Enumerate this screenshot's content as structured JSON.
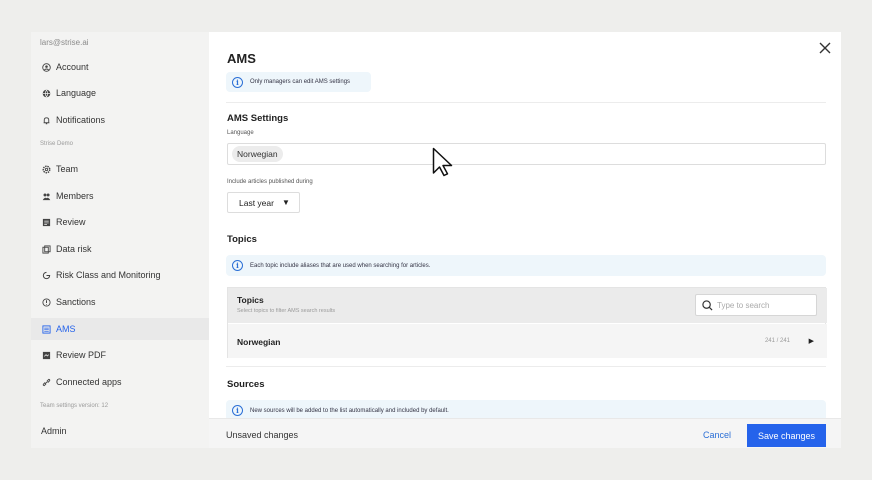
{
  "sidebar": {
    "email": "lars@strise.ai",
    "items_top": [
      {
        "label": "Account",
        "icon": "account-icon"
      },
      {
        "label": "Language",
        "icon": "globe-icon"
      },
      {
        "label": "Notifications",
        "icon": "bell-icon"
      }
    ],
    "section_label": "Strise Demo",
    "items_team": [
      {
        "label": "Team",
        "icon": "gear-icon"
      },
      {
        "label": "Members",
        "icon": "members-icon"
      },
      {
        "label": "Review",
        "icon": "review-icon"
      },
      {
        "label": "Data risk",
        "icon": "data-risk-icon"
      },
      {
        "label": "Risk Class and Monitoring",
        "icon": "monitoring-icon"
      },
      {
        "label": "Sanctions",
        "icon": "sanctions-icon"
      },
      {
        "label": "AMS",
        "icon": "ams-icon",
        "active": true
      },
      {
        "label": "Review PDF",
        "icon": "pdf-icon"
      },
      {
        "label": "Connected apps",
        "icon": "link-icon"
      }
    ],
    "version": "Team settings version: 12",
    "admin": "Admin"
  },
  "main": {
    "title": "AMS",
    "managers_notice": "Only managers can edit AMS settings",
    "settings_heading": "AMS Settings",
    "language_label": "Language",
    "language_value": "Norwegian",
    "period_label": "Include articles published during",
    "period_value": "Last year",
    "topics_heading": "Topics",
    "topics_notice": "Each topic include aliases that are used when searching for articles.",
    "topics_table": {
      "title": "Topics",
      "subtitle": "Select topics to filter AMS search results",
      "search_placeholder": "Type to search",
      "rows": [
        {
          "name": "Norwegian",
          "count": "241 / 241"
        }
      ]
    },
    "sources_heading": "Sources",
    "sources_notice": "New sources will be added to the list automatically and included by default."
  },
  "footer": {
    "status": "Unsaved changes",
    "cancel": "Cancel",
    "save": "Save changes"
  },
  "colors": {
    "accent": "#2563eb",
    "info_bg": "#eef6fb"
  }
}
